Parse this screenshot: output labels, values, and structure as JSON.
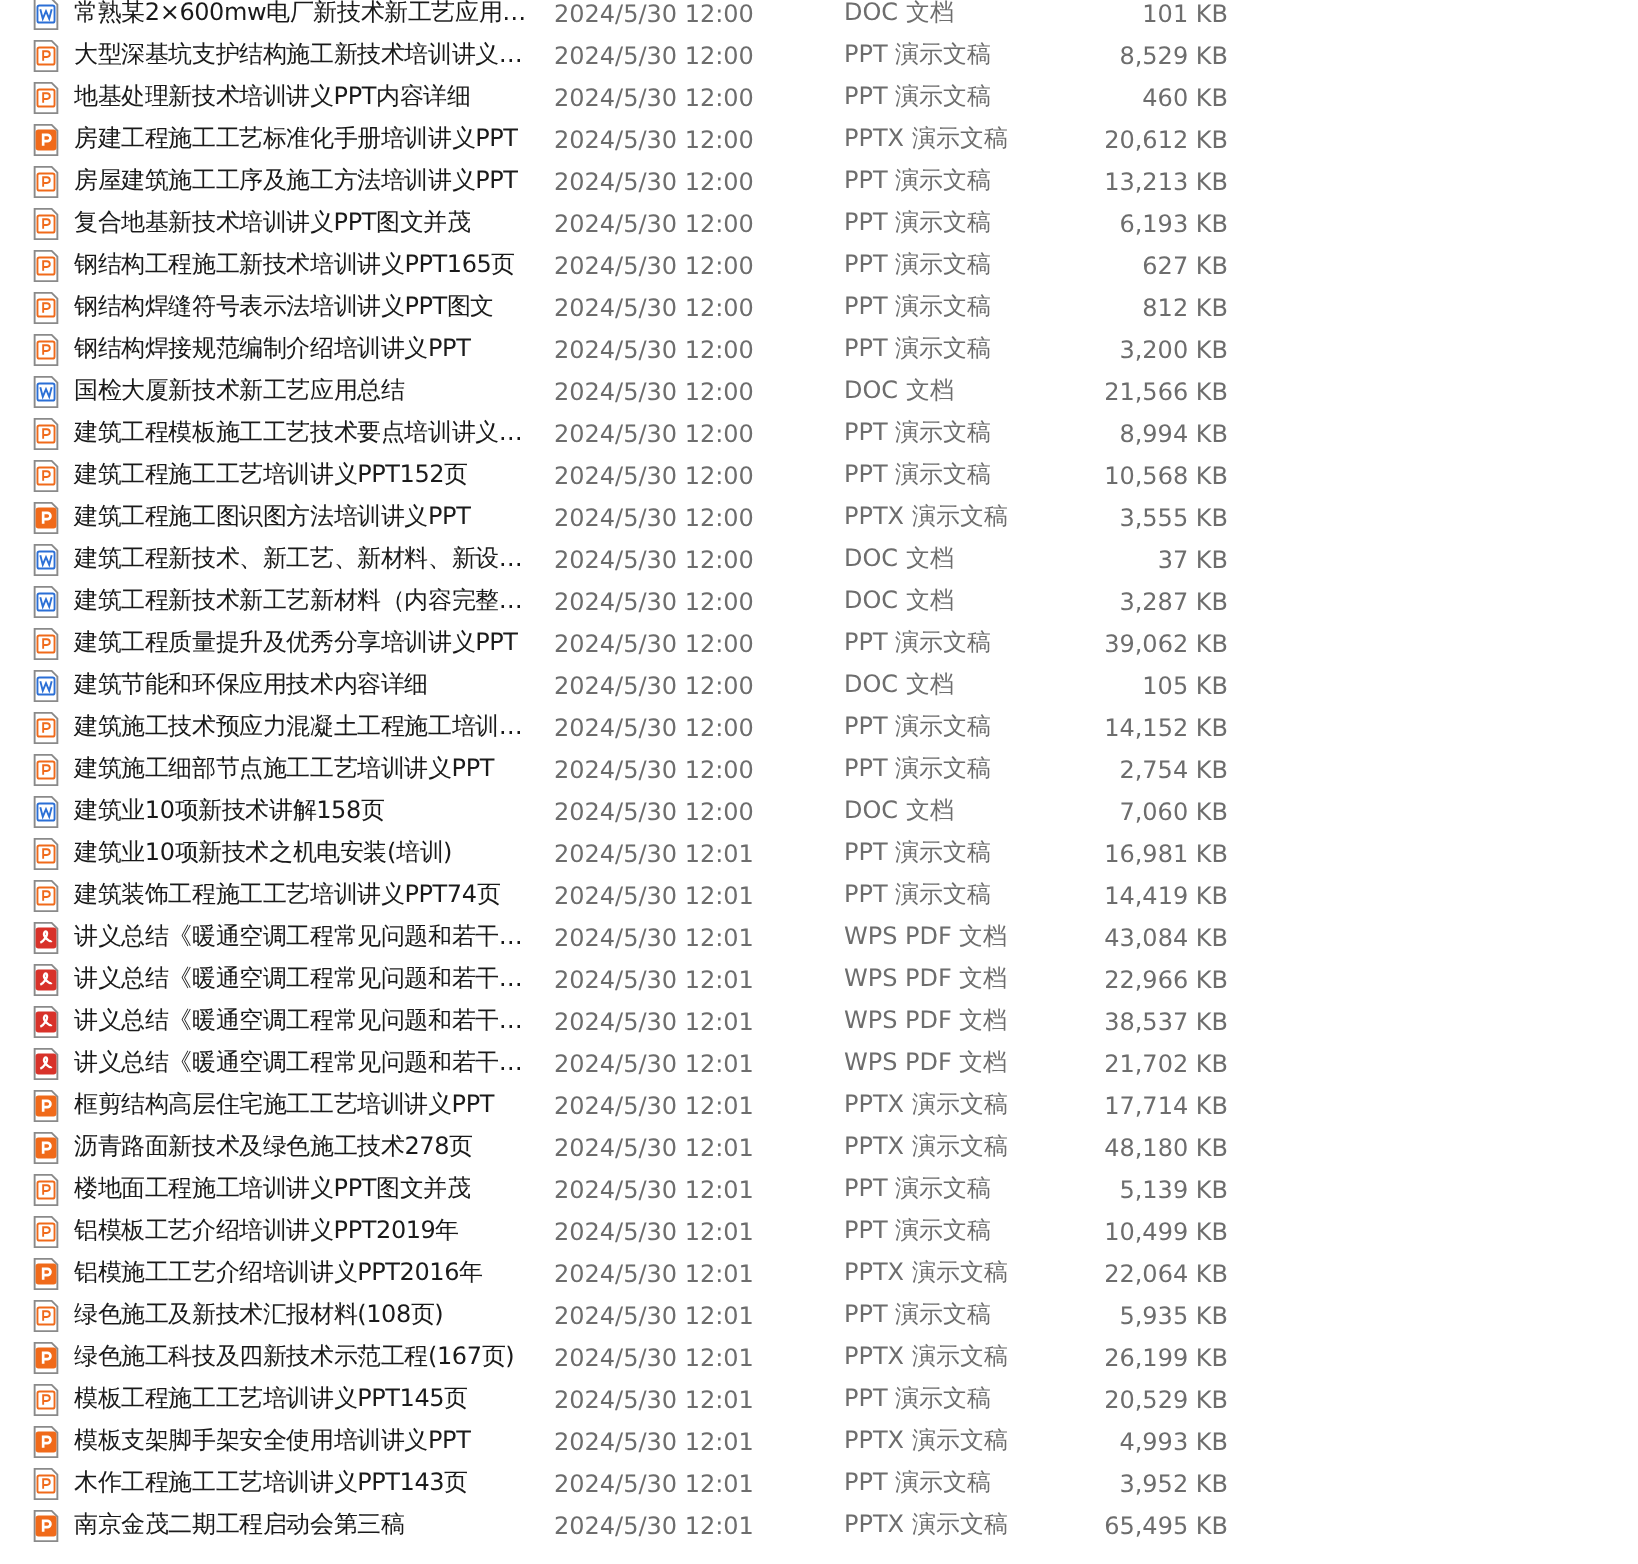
{
  "files": [
    {
      "kind": "doc",
      "name": "常熟某2×600mw电厂新技术新工艺应用…",
      "date": "2024/5/30 12:00",
      "type": "DOC 文档",
      "size": "101 KB"
    },
    {
      "kind": "ppt",
      "name": "大型深基坑支护结构施工新技术培训讲义…",
      "date": "2024/5/30 12:00",
      "type": "PPT 演示文稿",
      "size": "8,529 KB"
    },
    {
      "kind": "ppt",
      "name": "地基处理新技术培训讲义PPT内容详细",
      "date": "2024/5/30 12:00",
      "type": "PPT 演示文稿",
      "size": "460 KB"
    },
    {
      "kind": "pptx",
      "name": "房建工程施工工艺标准化手册培训讲义PPT",
      "date": "2024/5/30 12:00",
      "type": "PPTX 演示文稿",
      "size": "20,612 KB"
    },
    {
      "kind": "ppt",
      "name": "房屋建筑施工工序及施工方法培训讲义PPT",
      "date": "2024/5/30 12:00",
      "type": "PPT 演示文稿",
      "size": "13,213 KB"
    },
    {
      "kind": "ppt",
      "name": "复合地基新技术培训讲义PPT图文并茂",
      "date": "2024/5/30 12:00",
      "type": "PPT 演示文稿",
      "size": "6,193 KB"
    },
    {
      "kind": "ppt",
      "name": "钢结构工程施工新技术培训讲义PPT165页",
      "date": "2024/5/30 12:00",
      "type": "PPT 演示文稿",
      "size": "627 KB"
    },
    {
      "kind": "ppt",
      "name": "钢结构焊缝符号表示法培训讲义PPT图文",
      "date": "2024/5/30 12:00",
      "type": "PPT 演示文稿",
      "size": "812 KB"
    },
    {
      "kind": "ppt",
      "name": "钢结构焊接规范编制介绍培训讲义PPT",
      "date": "2024/5/30 12:00",
      "type": "PPT 演示文稿",
      "size": "3,200 KB"
    },
    {
      "kind": "doc",
      "name": "国检大厦新技术新工艺应用总结",
      "date": "2024/5/30 12:00",
      "type": "DOC 文档",
      "size": "21,566 KB"
    },
    {
      "kind": "ppt",
      "name": "建筑工程模板施工工艺技术要点培训讲义…",
      "date": "2024/5/30 12:00",
      "type": "PPT 演示文稿",
      "size": "8,994 KB"
    },
    {
      "kind": "ppt",
      "name": "建筑工程施工工艺培训讲义PPT152页",
      "date": "2024/5/30 12:00",
      "type": "PPT 演示文稿",
      "size": "10,568 KB"
    },
    {
      "kind": "pptx",
      "name": "建筑工程施工图识图方法培训讲义PPT",
      "date": "2024/5/30 12:00",
      "type": "PPTX 演示文稿",
      "size": "3,555 KB"
    },
    {
      "kind": "doc",
      "name": "建筑工程新技术、新工艺、新材料、新设…",
      "date": "2024/5/30 12:00",
      "type": "DOC 文档",
      "size": "37 KB"
    },
    {
      "kind": "doc",
      "name": "建筑工程新技术新工艺新材料（内容完整…",
      "date": "2024/5/30 12:00",
      "type": "DOC 文档",
      "size": "3,287 KB"
    },
    {
      "kind": "ppt",
      "name": "建筑工程质量提升及优秀分享培训讲义PPT",
      "date": "2024/5/30 12:00",
      "type": "PPT 演示文稿",
      "size": "39,062 KB"
    },
    {
      "kind": "doc",
      "name": "建筑节能和环保应用技术内容详细",
      "date": "2024/5/30 12:00",
      "type": "DOC 文档",
      "size": "105 KB"
    },
    {
      "kind": "ppt",
      "name": "建筑施工技术预应力混凝土工程施工培训…",
      "date": "2024/5/30 12:00",
      "type": "PPT 演示文稿",
      "size": "14,152 KB"
    },
    {
      "kind": "ppt",
      "name": "建筑施工细部节点施工工艺培训讲义PPT",
      "date": "2024/5/30 12:00",
      "type": "PPT 演示文稿",
      "size": "2,754 KB"
    },
    {
      "kind": "doc",
      "name": "建筑业10项新技术讲解158页",
      "date": "2024/5/30 12:00",
      "type": "DOC 文档",
      "size": "7,060 KB"
    },
    {
      "kind": "ppt",
      "name": "建筑业10项新技术之机电安装(培训)",
      "date": "2024/5/30 12:01",
      "type": "PPT 演示文稿",
      "size": "16,981 KB"
    },
    {
      "kind": "ppt",
      "name": "建筑装饰工程施工工艺培训讲义PPT74页",
      "date": "2024/5/30 12:01",
      "type": "PPT 演示文稿",
      "size": "14,419 KB"
    },
    {
      "kind": "pdf",
      "name": "讲义总结《暖通空调工程常见问题和若干…",
      "date": "2024/5/30 12:01",
      "type": "WPS PDF 文档",
      "size": "43,084 KB"
    },
    {
      "kind": "pdf",
      "name": "讲义总结《暖通空调工程常见问题和若干…",
      "date": "2024/5/30 12:01",
      "type": "WPS PDF 文档",
      "size": "22,966 KB"
    },
    {
      "kind": "pdf",
      "name": "讲义总结《暖通空调工程常见问题和若干…",
      "date": "2024/5/30 12:01",
      "type": "WPS PDF 文档",
      "size": "38,537 KB"
    },
    {
      "kind": "pdf",
      "name": "讲义总结《暖通空调工程常见问题和若干…",
      "date": "2024/5/30 12:01",
      "type": "WPS PDF 文档",
      "size": "21,702 KB"
    },
    {
      "kind": "pptx",
      "name": "框剪结构高层住宅施工工艺培训讲义PPT",
      "date": "2024/5/30 12:01",
      "type": "PPTX 演示文稿",
      "size": "17,714 KB"
    },
    {
      "kind": "pptx",
      "name": "沥青路面新技术及绿色施工技术278页",
      "date": "2024/5/30 12:01",
      "type": "PPTX 演示文稿",
      "size": "48,180 KB"
    },
    {
      "kind": "ppt",
      "name": "楼地面工程施工培训讲义PPT图文并茂",
      "date": "2024/5/30 12:01",
      "type": "PPT 演示文稿",
      "size": "5,139 KB"
    },
    {
      "kind": "ppt",
      "name": "铝模板工艺介绍培训讲义PPT2019年",
      "date": "2024/5/30 12:01",
      "type": "PPT 演示文稿",
      "size": "10,499 KB"
    },
    {
      "kind": "pptx",
      "name": "铝模施工工艺介绍培训讲义PPT2016年",
      "date": "2024/5/30 12:01",
      "type": "PPTX 演示文稿",
      "size": "22,064 KB"
    },
    {
      "kind": "ppt",
      "name": "绿色施工及新技术汇报材料(108页)",
      "date": "2024/5/30 12:01",
      "type": "PPT 演示文稿",
      "size": "5,935 KB"
    },
    {
      "kind": "pptx",
      "name": "绿色施工科技及四新技术示范工程(167页)",
      "date": "2024/5/30 12:01",
      "type": "PPTX 演示文稿",
      "size": "26,199 KB"
    },
    {
      "kind": "ppt",
      "name": "模板工程施工工艺培训讲义PPT145页",
      "date": "2024/5/30 12:01",
      "type": "PPT 演示文稿",
      "size": "20,529 KB"
    },
    {
      "kind": "pptx",
      "name": "模板支架脚手架安全使用培训讲义PPT",
      "date": "2024/5/30 12:01",
      "type": "PPTX 演示文稿",
      "size": "4,993 KB"
    },
    {
      "kind": "ppt",
      "name": "木作工程施工工艺培训讲义PPT143页",
      "date": "2024/5/30 12:01",
      "type": "PPT 演示文稿",
      "size": "3,952 KB"
    },
    {
      "kind": "pptx",
      "name": "南京金茂二期工程启动会第三稿",
      "date": "2024/5/30 12:01",
      "type": "PPTX 演示文稿",
      "size": "65,495 KB"
    }
  ]
}
